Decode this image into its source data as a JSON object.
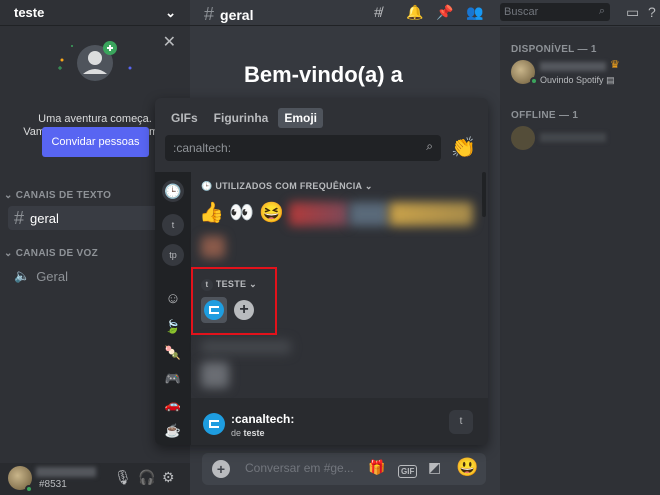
{
  "server": {
    "name": "teste"
  },
  "welcome": {
    "line1": "Uma aventura começa.",
    "line2": "Vamos adicionar alguns amig",
    "invite_label": "Convidar pessoas"
  },
  "categories": {
    "text": "CANAIS DE TEXTO",
    "voice": "CANAIS DE VOZ"
  },
  "channels": {
    "text_channel": "geral",
    "voice_channel": "Geral"
  },
  "topbar": {
    "channel": "geral",
    "search_placeholder": "Buscar"
  },
  "main": {
    "welcome_title": "Bem-vindo(a) a"
  },
  "members": {
    "online_header": "DISPONÍVEL — 1",
    "online_status": "Ouvindo Spotify",
    "offline_header": "OFFLINE — 1"
  },
  "user": {
    "tag": "#8531"
  },
  "composer": {
    "placeholder": "Conversar em #ge..."
  },
  "picker": {
    "tabs": [
      "GIFs",
      "Figurinha",
      "Emoji"
    ],
    "active_tab": "Emoji",
    "search_value": ":canaltech:",
    "frequent_header": "UTILIZADOS COM FREQUÊNCIA",
    "frequent_emojis": [
      "👍",
      "👀",
      "😆"
    ],
    "server_section": "TESTE",
    "server_initial": "t",
    "sidebar_servers": [
      "t",
      "tp"
    ],
    "footer_name": ":canaltech:",
    "footer_prefix": "de",
    "footer_server": "teste",
    "footer_badge": "t"
  },
  "colors": {
    "accent": "#5865f2",
    "highlight": "#e3121b",
    "online": "#3ba55d",
    "canaltech": "#1e9de0"
  }
}
